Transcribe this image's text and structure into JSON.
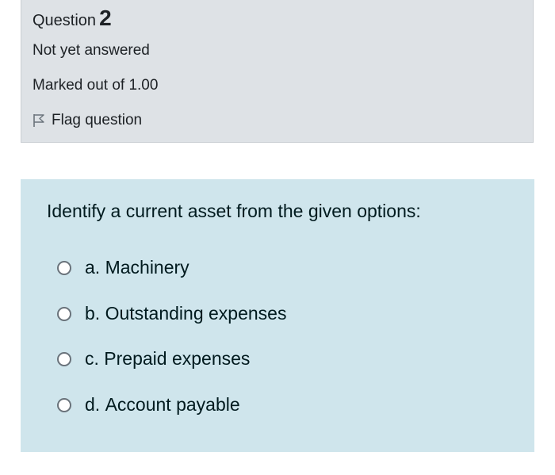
{
  "info": {
    "question_label": "Question",
    "question_number": "2",
    "state": "Not yet answered",
    "grade": "Marked out of 1.00",
    "flag_label": "Flag question"
  },
  "question": {
    "text": "Identify a current asset from the given options:",
    "options": [
      {
        "letter": "a.",
        "label": "Machinery"
      },
      {
        "letter": "b.",
        "label": "Outstanding expenses"
      },
      {
        "letter": "c.",
        "label": "Prepaid expenses"
      },
      {
        "letter": "d.",
        "label": "Account payable"
      }
    ]
  },
  "colors": {
    "info_background": "#dee2e6",
    "question_background": "#cfe5ec",
    "text": "#1d2125"
  },
  "icons": {
    "flag": "flag-outline-icon",
    "radio": "radio-unchecked-icon"
  }
}
